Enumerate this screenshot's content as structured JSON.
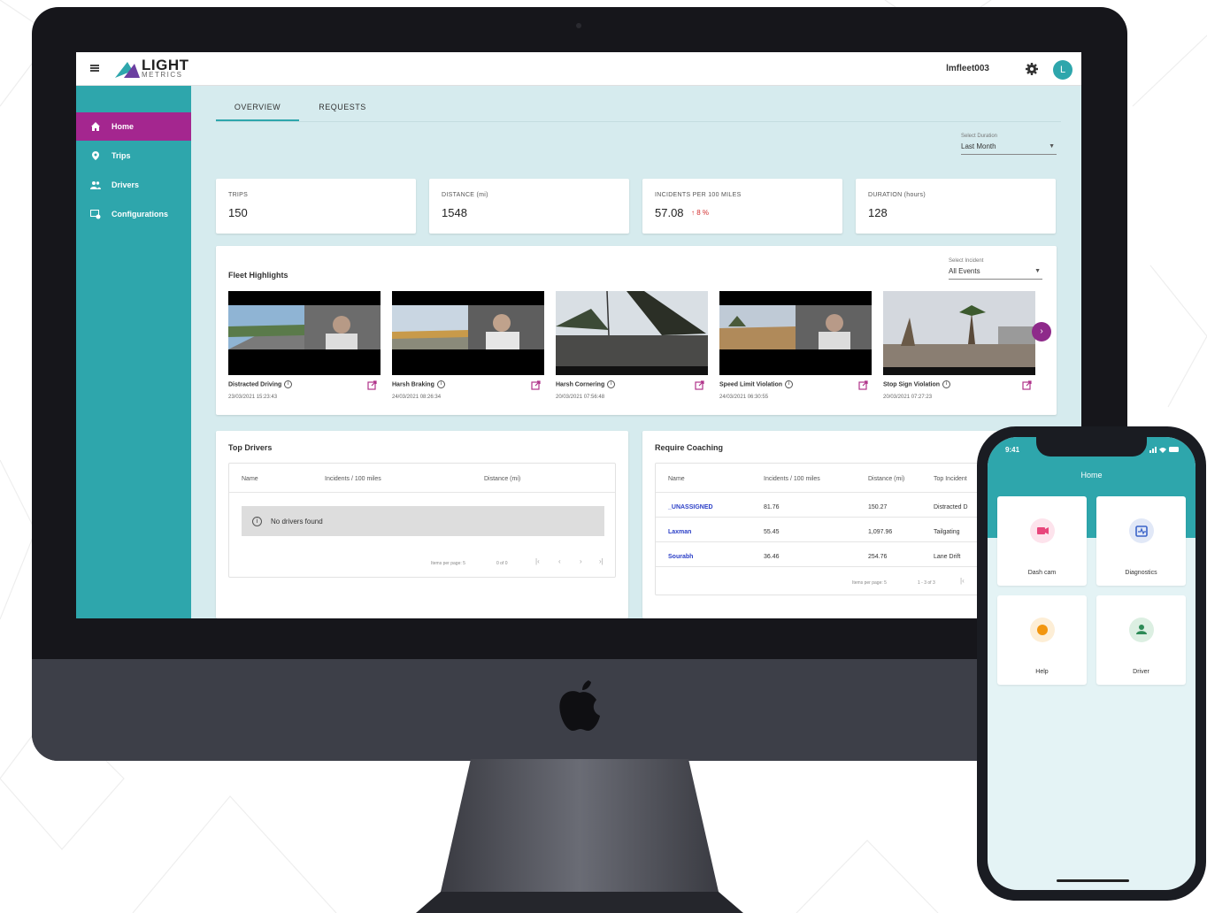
{
  "app": {
    "brand_name": "LIGHT",
    "brand_sub": "METRICS",
    "username": "lmfleet003",
    "avatar_initial": "L",
    "accent": "#2ea6ac",
    "active_color": "#a4268f"
  },
  "sidebar": {
    "items": [
      {
        "label": "Home",
        "icon": "home-icon"
      },
      {
        "label": "Trips",
        "icon": "location-pin-icon"
      },
      {
        "label": "Drivers",
        "icon": "people-icon"
      },
      {
        "label": "Configurations",
        "icon": "config-icon"
      }
    ]
  },
  "tabs": [
    {
      "label": "OVERVIEW"
    },
    {
      "label": "REQUESTS"
    }
  ],
  "period_select": {
    "label": "Select Duration",
    "value": "Last Month"
  },
  "stats": [
    {
      "label": "TRIPS",
      "value": "150"
    },
    {
      "label": "DISTANCE (mi)",
      "value": "1548"
    },
    {
      "label": "INCIDENTS PER 100 MILES",
      "value": "57.08",
      "trend": "↑ 8 %"
    },
    {
      "label": "DURATION (hours)",
      "value": "128"
    }
  ],
  "highlights": {
    "title": "Fleet Highlights",
    "incident_select": {
      "label": "Select Incident",
      "value": "All Events"
    },
    "clips": [
      {
        "title": "Distracted Driving",
        "time": "23/03/2021 15:23:43"
      },
      {
        "title": "Harsh Braking",
        "time": "24/03/2021 08:26:34"
      },
      {
        "title": "Harsh Cornering",
        "time": "20/03/2021 07:56:48"
      },
      {
        "title": "Speed Limit Violation",
        "time": "24/03/2021 06:30:55"
      },
      {
        "title": "Stop Sign Violation",
        "time": "20/03/2021 07:27:23"
      }
    ]
  },
  "top_drivers": {
    "title": "Top Drivers",
    "columns": [
      "Name",
      "Incidents / 100 miles",
      "Distance (mi)"
    ],
    "empty_text": "No drivers found",
    "pager_label": "Items per page: 5",
    "pager_range": "0 of 0"
  },
  "require_coaching": {
    "title": "Require Coaching",
    "columns": [
      "Name",
      "Incidents / 100 miles",
      "Distance (mi)",
      "Top Incident"
    ],
    "rows": [
      {
        "name": "_UNASSIGNED",
        "incidents": "81.76",
        "distance": "150.27",
        "top": "Distracted D"
      },
      {
        "name": "Laxman",
        "incidents": "55.45",
        "distance": "1,097.96",
        "top": "Tailgating"
      },
      {
        "name": "Sourabh",
        "incidents": "36.46",
        "distance": "254.76",
        "top": "Lane Drift"
      }
    ],
    "pager_label": "Items per page: 5",
    "pager_range": "1 - 3 of 3"
  },
  "phone": {
    "time": "9:41",
    "title": "Home",
    "tiles": [
      {
        "label": "Dash cam",
        "icon": "camera-icon",
        "color": "#e8467c"
      },
      {
        "label": "Diagnostics",
        "icon": "diagnostics-icon",
        "color": "#3a63c8"
      },
      {
        "label": "Help",
        "icon": "help-icon",
        "color": "#f2960f"
      },
      {
        "label": "Driver",
        "icon": "driver-icon",
        "color": "#2e8b57"
      }
    ]
  }
}
